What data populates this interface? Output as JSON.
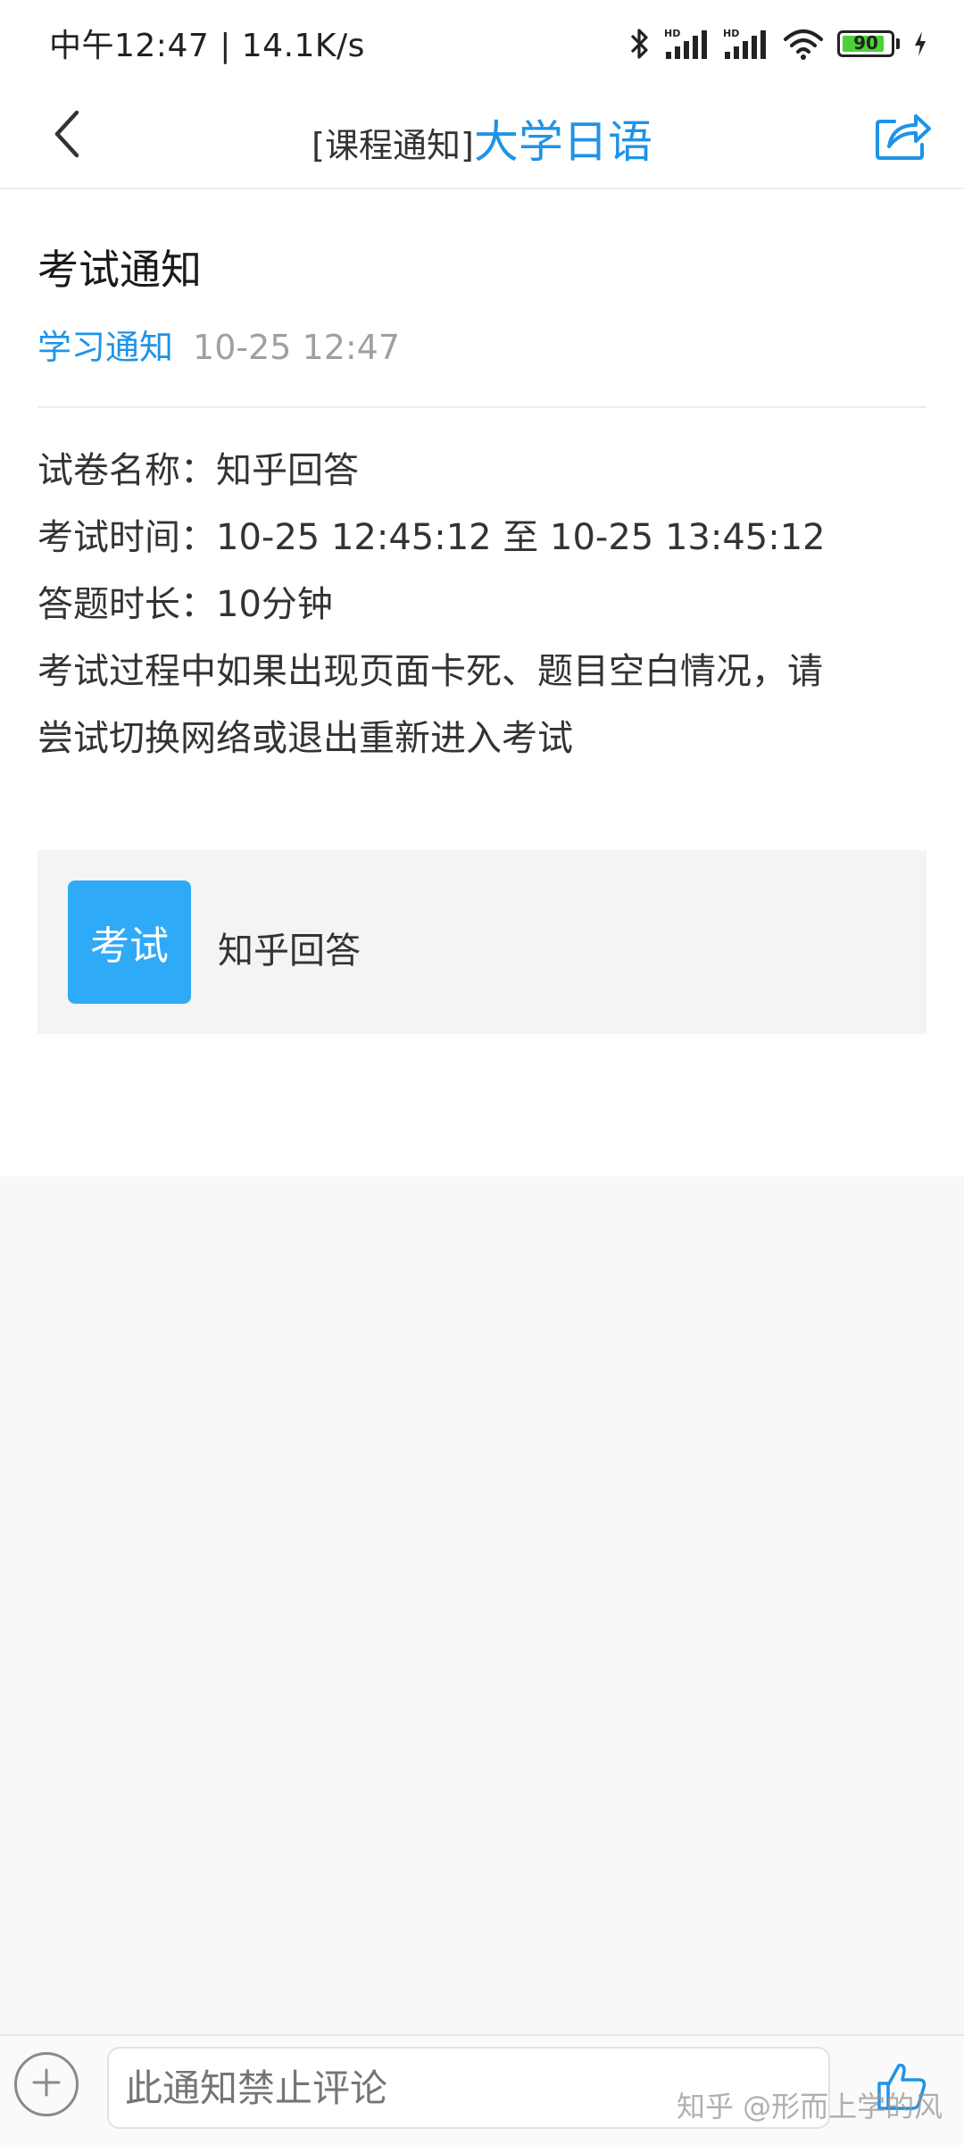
{
  "status_bar": {
    "time_speed": "中午12:47 | 14.1K/s",
    "battery": "90",
    "hd_label": "HD"
  },
  "header": {
    "prefix": "[课程通知]",
    "course": "大学日语"
  },
  "notice": {
    "title": "考试通知",
    "category": "学习通知",
    "time": "10-25 12:47",
    "lines": [
      "试卷名称：知乎回答",
      "考试时间：10-25 12:45:12 至 10-25 13:45:12",
      "答题时长：10分钟",
      "考试过程中如果出现页面卡死、题目空白情况，请",
      "尝试切换网络或退出重新进入考试"
    ]
  },
  "exam_card": {
    "badge": "考试",
    "name": "知乎回答"
  },
  "bottom_bar": {
    "comment_placeholder": "此通知禁止评论",
    "watermark": "知乎 @形而上学的风"
  },
  "colors": {
    "accent": "#1f93e6",
    "badge": "#2eaaf6",
    "battery_fill": "#4cd137"
  },
  "icons": [
    "back-arrow-icon",
    "share-icon",
    "bluetooth-icon",
    "signal-icon",
    "wifi-icon",
    "battery-icon",
    "charging-icon",
    "add-icon",
    "thumbs-up-icon"
  ]
}
